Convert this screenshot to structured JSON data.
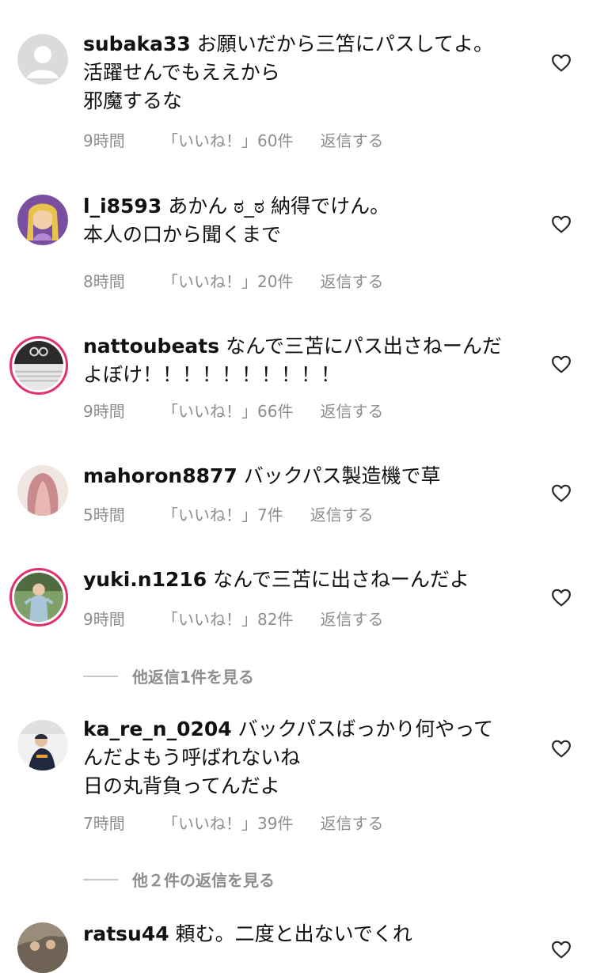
{
  "comments": [
    {
      "username": "subaka33",
      "lines": [
        "お願いだから三笘にパスしてよ。",
        "活躍せんでもええから",
        "邪魔するな"
      ],
      "time": "9時間",
      "likes": "「いいね！」60件",
      "reply": "返信する"
    },
    {
      "username": "l_i8593",
      "lines": [
        "あかん ಠ_ಠ 納得でけん。",
        "本人の口から聞くまで"
      ],
      "time": "8時間",
      "likes": "「いいね！」20件",
      "reply": "返信する"
    },
    {
      "username": "nattoubeats",
      "lines": [
        "なんで三苫にパス出さねーんだ",
        "よぼけ！！！！！！！！！！"
      ],
      "time": "9時間",
      "likes": "「いいね！」66件",
      "reply": "返信する"
    },
    {
      "username": "mahoron8877",
      "lines": [
        "バックパス製造機で草"
      ],
      "time": "5時間",
      "likes": "「いいね！」7件",
      "reply": "返信する"
    },
    {
      "username": "yuki.n1216",
      "lines": [
        "なんで三苫に出さねーんだよ"
      ],
      "time": "9時間",
      "likes": "「いいね！」82件",
      "reply": "返信する"
    },
    {
      "username": "ka_re_n_0204",
      "lines": [
        "バックパスばっかり何やって",
        "んだよもう呼ばれないね",
        "日の丸背負ってんだよ"
      ],
      "time": "7時間",
      "likes": "「いいね！」39件",
      "reply": "返信する"
    },
    {
      "username": "ratsu44",
      "lines": [
        "頼む。二度と出ないでくれ"
      ],
      "time": "",
      "likes": "",
      "reply": ""
    }
  ],
  "view_replies": [
    {
      "label": "他返信1件を見る"
    },
    {
      "label": "他２件の返信を見る"
    }
  ],
  "icons": {
    "like": "heart-outline-icon",
    "avatar_placeholder": "default-avatar-icon"
  },
  "colors": {
    "text": "#111111",
    "meta": "#8e8e8e",
    "story_ring": "#e1306c"
  }
}
